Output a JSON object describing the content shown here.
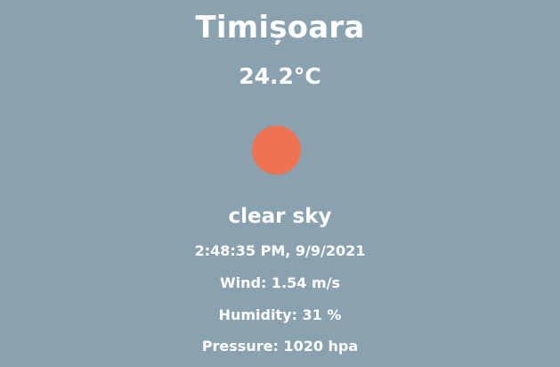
{
  "city": "Timișoara",
  "temperature": "24.2°C",
  "condition": {
    "icon": "sun-icon",
    "color": "#ed7352",
    "description": "clear sky"
  },
  "datetime": "2:48:35 PM, 9/9/2021",
  "stats": {
    "wind": "Wind: 1.54 m/s",
    "humidity": "Humidity: 31 %",
    "pressure": "Pressure: 1020 hpa"
  },
  "colors": {
    "background": "#8aa2b0",
    "text": "#ffffff"
  }
}
